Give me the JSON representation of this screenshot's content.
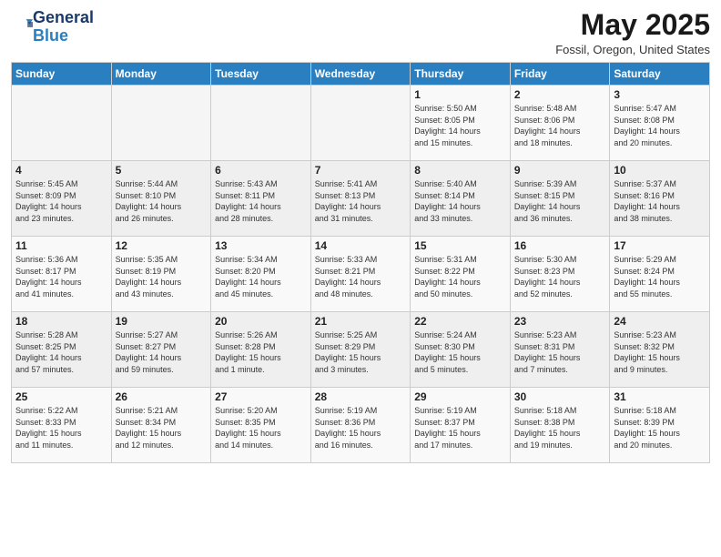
{
  "logo": {
    "line1": "General",
    "line2": "Blue"
  },
  "title": {
    "month_year": "May 2025",
    "location": "Fossil, Oregon, United States"
  },
  "weekdays": [
    "Sunday",
    "Monday",
    "Tuesday",
    "Wednesday",
    "Thursday",
    "Friday",
    "Saturday"
  ],
  "weeks": [
    [
      {
        "day": "",
        "info": ""
      },
      {
        "day": "",
        "info": ""
      },
      {
        "day": "",
        "info": ""
      },
      {
        "day": "",
        "info": ""
      },
      {
        "day": "1",
        "info": "Sunrise: 5:50 AM\nSunset: 8:05 PM\nDaylight: 14 hours\nand 15 minutes."
      },
      {
        "day": "2",
        "info": "Sunrise: 5:48 AM\nSunset: 8:06 PM\nDaylight: 14 hours\nand 18 minutes."
      },
      {
        "day": "3",
        "info": "Sunrise: 5:47 AM\nSunset: 8:08 PM\nDaylight: 14 hours\nand 20 minutes."
      }
    ],
    [
      {
        "day": "4",
        "info": "Sunrise: 5:45 AM\nSunset: 8:09 PM\nDaylight: 14 hours\nand 23 minutes."
      },
      {
        "day": "5",
        "info": "Sunrise: 5:44 AM\nSunset: 8:10 PM\nDaylight: 14 hours\nand 26 minutes."
      },
      {
        "day": "6",
        "info": "Sunrise: 5:43 AM\nSunset: 8:11 PM\nDaylight: 14 hours\nand 28 minutes."
      },
      {
        "day": "7",
        "info": "Sunrise: 5:41 AM\nSunset: 8:13 PM\nDaylight: 14 hours\nand 31 minutes."
      },
      {
        "day": "8",
        "info": "Sunrise: 5:40 AM\nSunset: 8:14 PM\nDaylight: 14 hours\nand 33 minutes."
      },
      {
        "day": "9",
        "info": "Sunrise: 5:39 AM\nSunset: 8:15 PM\nDaylight: 14 hours\nand 36 minutes."
      },
      {
        "day": "10",
        "info": "Sunrise: 5:37 AM\nSunset: 8:16 PM\nDaylight: 14 hours\nand 38 minutes."
      }
    ],
    [
      {
        "day": "11",
        "info": "Sunrise: 5:36 AM\nSunset: 8:17 PM\nDaylight: 14 hours\nand 41 minutes."
      },
      {
        "day": "12",
        "info": "Sunrise: 5:35 AM\nSunset: 8:19 PM\nDaylight: 14 hours\nand 43 minutes."
      },
      {
        "day": "13",
        "info": "Sunrise: 5:34 AM\nSunset: 8:20 PM\nDaylight: 14 hours\nand 45 minutes."
      },
      {
        "day": "14",
        "info": "Sunrise: 5:33 AM\nSunset: 8:21 PM\nDaylight: 14 hours\nand 48 minutes."
      },
      {
        "day": "15",
        "info": "Sunrise: 5:31 AM\nSunset: 8:22 PM\nDaylight: 14 hours\nand 50 minutes."
      },
      {
        "day": "16",
        "info": "Sunrise: 5:30 AM\nSunset: 8:23 PM\nDaylight: 14 hours\nand 52 minutes."
      },
      {
        "day": "17",
        "info": "Sunrise: 5:29 AM\nSunset: 8:24 PM\nDaylight: 14 hours\nand 55 minutes."
      }
    ],
    [
      {
        "day": "18",
        "info": "Sunrise: 5:28 AM\nSunset: 8:25 PM\nDaylight: 14 hours\nand 57 minutes."
      },
      {
        "day": "19",
        "info": "Sunrise: 5:27 AM\nSunset: 8:27 PM\nDaylight: 14 hours\nand 59 minutes."
      },
      {
        "day": "20",
        "info": "Sunrise: 5:26 AM\nSunset: 8:28 PM\nDaylight: 15 hours\nand 1 minute."
      },
      {
        "day": "21",
        "info": "Sunrise: 5:25 AM\nSunset: 8:29 PM\nDaylight: 15 hours\nand 3 minutes."
      },
      {
        "day": "22",
        "info": "Sunrise: 5:24 AM\nSunset: 8:30 PM\nDaylight: 15 hours\nand 5 minutes."
      },
      {
        "day": "23",
        "info": "Sunrise: 5:23 AM\nSunset: 8:31 PM\nDaylight: 15 hours\nand 7 minutes."
      },
      {
        "day": "24",
        "info": "Sunrise: 5:23 AM\nSunset: 8:32 PM\nDaylight: 15 hours\nand 9 minutes."
      }
    ],
    [
      {
        "day": "25",
        "info": "Sunrise: 5:22 AM\nSunset: 8:33 PM\nDaylight: 15 hours\nand 11 minutes."
      },
      {
        "day": "26",
        "info": "Sunrise: 5:21 AM\nSunset: 8:34 PM\nDaylight: 15 hours\nand 12 minutes."
      },
      {
        "day": "27",
        "info": "Sunrise: 5:20 AM\nSunset: 8:35 PM\nDaylight: 15 hours\nand 14 minutes."
      },
      {
        "day": "28",
        "info": "Sunrise: 5:19 AM\nSunset: 8:36 PM\nDaylight: 15 hours\nand 16 minutes."
      },
      {
        "day": "29",
        "info": "Sunrise: 5:19 AM\nSunset: 8:37 PM\nDaylight: 15 hours\nand 17 minutes."
      },
      {
        "day": "30",
        "info": "Sunrise: 5:18 AM\nSunset: 8:38 PM\nDaylight: 15 hours\nand 19 minutes."
      },
      {
        "day": "31",
        "info": "Sunrise: 5:18 AM\nSunset: 8:39 PM\nDaylight: 15 hours\nand 20 minutes."
      }
    ]
  ]
}
